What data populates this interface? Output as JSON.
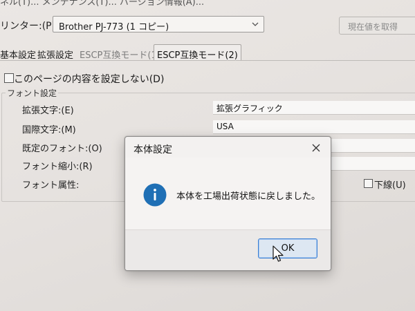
{
  "window": {
    "title_partial": "ネル(T)... メンテナンス(T)... バージョン情報(A)..."
  },
  "printer": {
    "label": "リンター:(P)",
    "selected": "Brother PJ-773 (1 コピー)",
    "reset_button": "現在値を取得"
  },
  "tabs": [
    {
      "label": "基本設定",
      "state": "normal"
    },
    {
      "label": "拡張設定",
      "state": "normal"
    },
    {
      "label": "ESCP互換モード(1)",
      "state": "dimmed"
    },
    {
      "label": "ESCP互換モード(2)",
      "state": "selected"
    }
  ],
  "page": {
    "nosave_checkbox_label": "このページの内容を設定しない(D)",
    "nosave_checked": false
  },
  "font_settings": {
    "group_label": "フォント設定",
    "rows": [
      {
        "label": "拡張文字:(E)",
        "value": "拡張グラフィック"
      },
      {
        "label": "国際文字:(M)",
        "value": "USA"
      },
      {
        "label": "既定のフォント:(O)",
        "value": ""
      },
      {
        "label": "フォント縮小:(R)",
        "value": ""
      },
      {
        "label": "フォント属性:",
        "value": ""
      }
    ],
    "underline_label": "下線(U)",
    "underline_checked": false
  },
  "dialog": {
    "title": "本体設定",
    "message": "本体を工場出荷状態に戻しました。",
    "ok_label": "OK",
    "icon": "info-icon",
    "accent_color": "#1f6fb5"
  }
}
